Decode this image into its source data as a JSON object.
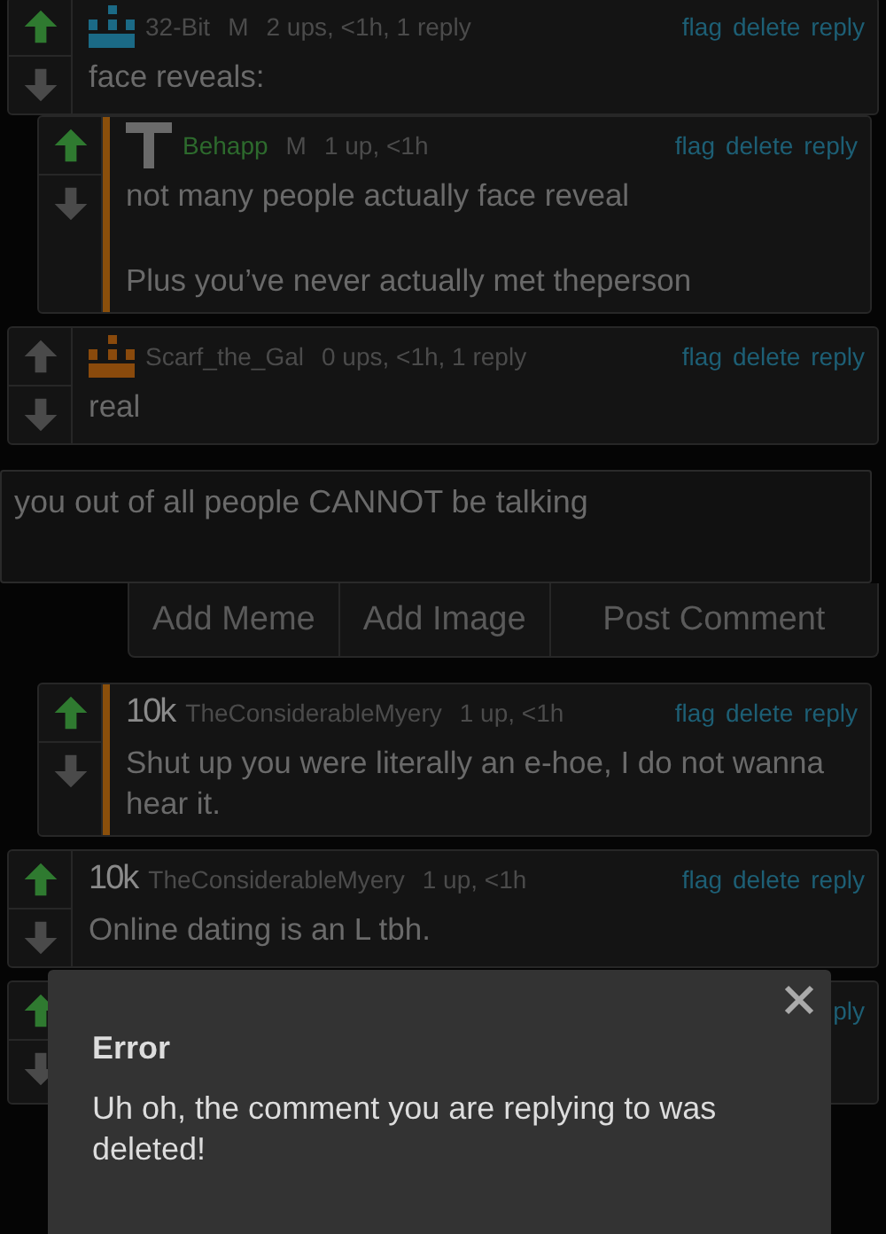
{
  "comments": [
    {
      "avatar": {
        "kind": "pixel",
        "color": "#1b6a86"
      },
      "user": "32-Bit",
      "op": false,
      "badge": "M",
      "stats": "2 ups, <1h, 1 reply",
      "actions": [
        "flag",
        "delete",
        "reply"
      ],
      "upvoted": true,
      "body": [
        "face reveals:"
      ],
      "children": [
        {
          "avatar": {
            "kind": "figure"
          },
          "user": "Behapp",
          "op": true,
          "badge": "M",
          "stats": "1 up, <1h",
          "actions": [
            "flag",
            "delete",
            "reply"
          ],
          "upvoted": true,
          "body": [
            "not many people actually face reveal",
            "Plus you’ve never actually met theperson"
          ]
        }
      ]
    },
    {
      "avatar": {
        "kind": "pixel",
        "color": "#8a4a0c"
      },
      "user": "Scarf_the_Gal",
      "op": false,
      "stats": "0 ups, <1h, 1 reply",
      "actions": [
        "flag",
        "delete",
        "reply"
      ],
      "upvoted": false,
      "body": [
        "real"
      ],
      "reply_form": {
        "value": "you out of all people CANNOT be talking",
        "buttons": [
          "Add Meme",
          "Add Image",
          "Post Comment"
        ]
      },
      "children": [
        {
          "avatar": {
            "kind": "text",
            "text": "10k"
          },
          "user": "TheConsiderableMyery",
          "op": false,
          "stats": "1 up, <1h",
          "actions": [
            "flag",
            "delete",
            "reply"
          ],
          "upvoted": true,
          "body": [
            "Shut up you were literally an e-hoe, I do not wanna hear it."
          ]
        }
      ]
    },
    {
      "avatar": {
        "kind": "text",
        "text": "10k"
      },
      "user": "TheConsiderableMyery",
      "op": false,
      "stats": "1 up, <1h",
      "actions": [
        "flag",
        "delete",
        "reply"
      ],
      "upvoted": true,
      "body": [
        "Online dating is an L tbh."
      ]
    },
    {
      "upvoted": true,
      "actions": [
        "ply"
      ]
    }
  ],
  "dialog": {
    "title": "Error",
    "message": "Uh oh, the comment you are replying to was deleted!"
  }
}
